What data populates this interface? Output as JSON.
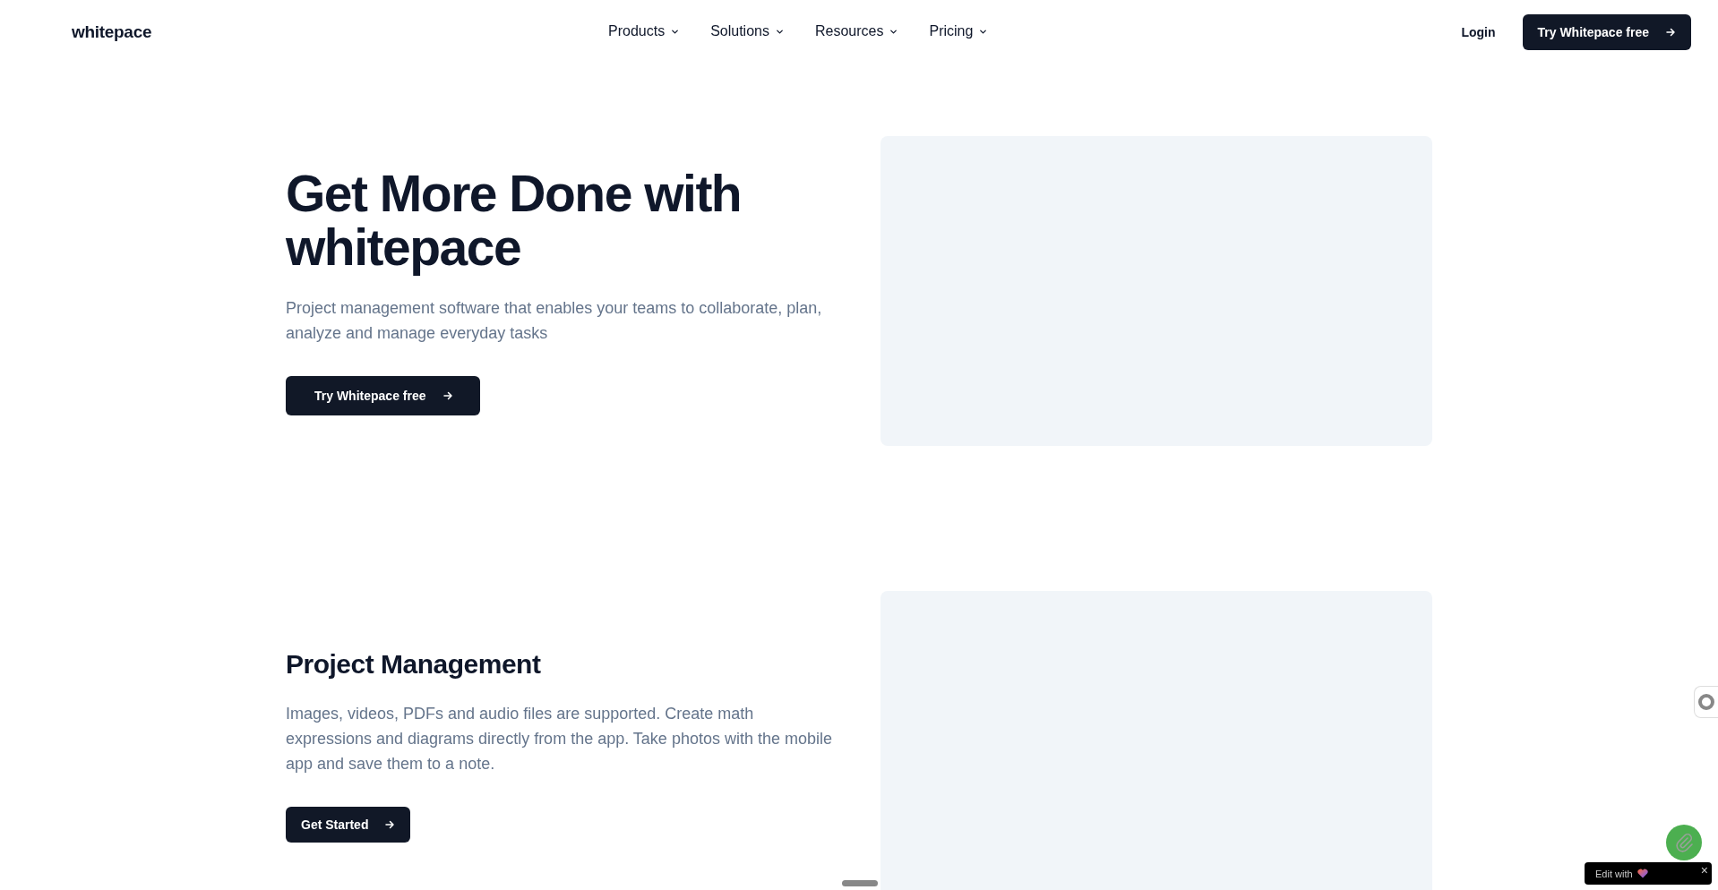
{
  "header": {
    "logo": "whitepace",
    "nav": [
      {
        "label": "Products"
      },
      {
        "label": "Solutions"
      },
      {
        "label": "Resources"
      },
      {
        "label": "Pricing"
      }
    ],
    "login": "Login",
    "cta": "Try Whitepace free"
  },
  "hero": {
    "title": "Get More Done with whitepace",
    "text": "Project management software that enables your teams to collaborate, plan, analyze and manage everyday tasks",
    "button": "Try Whitepace free"
  },
  "feature": {
    "title": "Project Management",
    "text": "Images, videos, PDFs and audio files are supported. Create math expressions and diagrams directly from the app. Take photos with the mobile app and save them to a note.",
    "button": "Get Started"
  },
  "badge": {
    "label": "Edit with",
    "close": "×"
  }
}
